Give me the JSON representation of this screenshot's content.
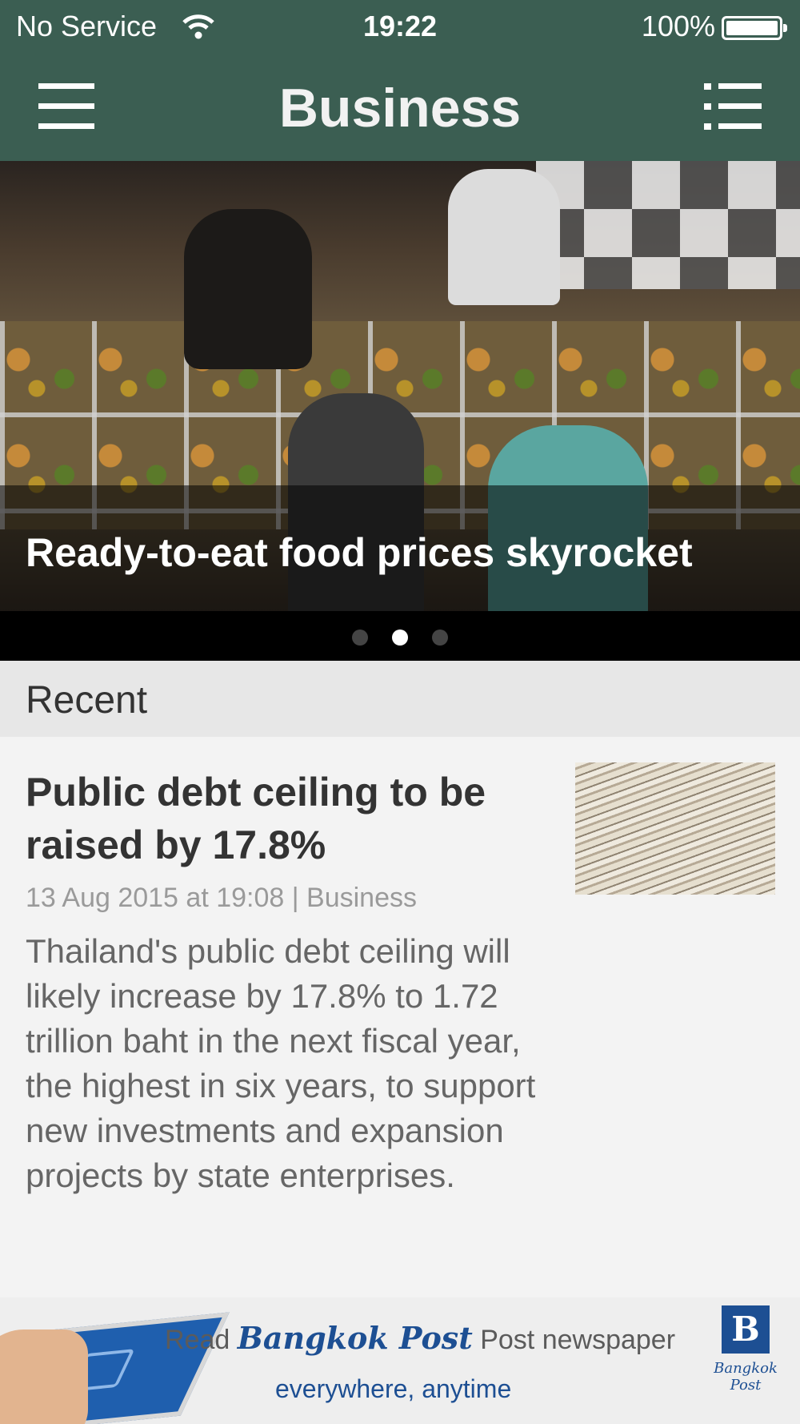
{
  "status_bar": {
    "carrier": "No Service",
    "time": "19:22",
    "battery_percent": "100%",
    "wifi_icon": "wifi-icon",
    "battery_icon": "battery-icon"
  },
  "nav": {
    "title": "Business",
    "left_icon": "hamburger-menu-icon",
    "right_icon": "list-icon",
    "background_color": "#3b5e52"
  },
  "hero": {
    "headline": "Ready-to-eat food prices skyrocket",
    "page_count": 3,
    "active_page": 2
  },
  "section": {
    "label": "Recent"
  },
  "articles": [
    {
      "headline": "Public debt ceiling to be raised by 17.8%",
      "meta": "13 Aug 2015 at 19:08 | Business",
      "summary": "Thailand's public debt ceiling will likely increase by 17.8% to 1.72 trillion baht in the next fiscal year, the highest in six years, to support new investments and expansion projects by state enterprises."
    }
  ],
  "ad": {
    "prefix": "Read",
    "brand": "Bangkok Post",
    "suffix": "Post newspaper",
    "tagline": "everywhere, anytime",
    "logo_letter": "B",
    "logo_text": "Bangkok Post",
    "accent_color": "#1d4f93"
  }
}
